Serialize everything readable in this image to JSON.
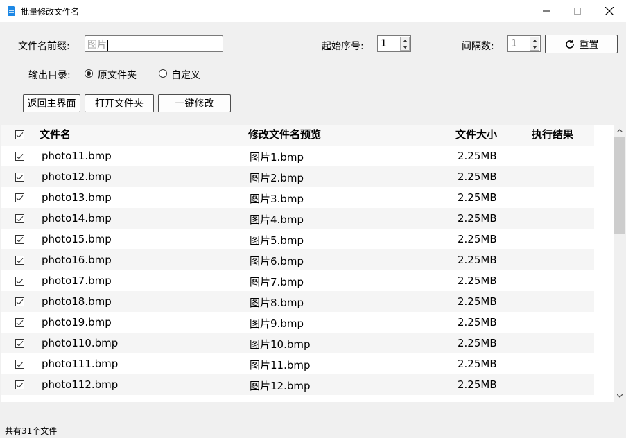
{
  "window": {
    "title": "批量修改文件名"
  },
  "form": {
    "prefix_label": "文件名前缀:",
    "prefix_placeholder": "图片",
    "start_label": "起始序号:",
    "start_value": "1",
    "interval_label": "间隔数:",
    "interval_value": "1",
    "reset_label": "重置",
    "output_label": "输出目录:",
    "radio_original": "原文件夹",
    "radio_custom": "自定义",
    "back_label": "返回主界面",
    "open_label": "打开文件夹",
    "rename_label": "一键修改"
  },
  "table": {
    "headers": [
      "文件名",
      "修改文件名预览",
      "文件大小",
      "执行结果"
    ],
    "rows": [
      {
        "name": "photo11.bmp",
        "preview": "图片1.bmp",
        "size": "2.25MB",
        "result": ""
      },
      {
        "name": "photo12.bmp",
        "preview": "图片2.bmp",
        "size": "2.25MB",
        "result": ""
      },
      {
        "name": "photo13.bmp",
        "preview": "图片3.bmp",
        "size": "2.25MB",
        "result": ""
      },
      {
        "name": "photo14.bmp",
        "preview": "图片4.bmp",
        "size": "2.25MB",
        "result": ""
      },
      {
        "name": "photo15.bmp",
        "preview": "图片5.bmp",
        "size": "2.25MB",
        "result": ""
      },
      {
        "name": "photo16.bmp",
        "preview": "图片6.bmp",
        "size": "2.25MB",
        "result": ""
      },
      {
        "name": "photo17.bmp",
        "preview": "图片7.bmp",
        "size": "2.25MB",
        "result": ""
      },
      {
        "name": "photo18.bmp",
        "preview": "图片8.bmp",
        "size": "2.25MB",
        "result": ""
      },
      {
        "name": "photo19.bmp",
        "preview": "图片9.bmp",
        "size": "2.25MB",
        "result": ""
      },
      {
        "name": "photo110.bmp",
        "preview": "图片10.bmp",
        "size": "2.25MB",
        "result": ""
      },
      {
        "name": "photo111.bmp",
        "preview": "图片11.bmp",
        "size": "2.25MB",
        "result": ""
      },
      {
        "name": "photo112.bmp",
        "preview": "图片12.bmp",
        "size": "2.25MB",
        "result": ""
      }
    ]
  },
  "status": {
    "text": "共有31个文件"
  }
}
